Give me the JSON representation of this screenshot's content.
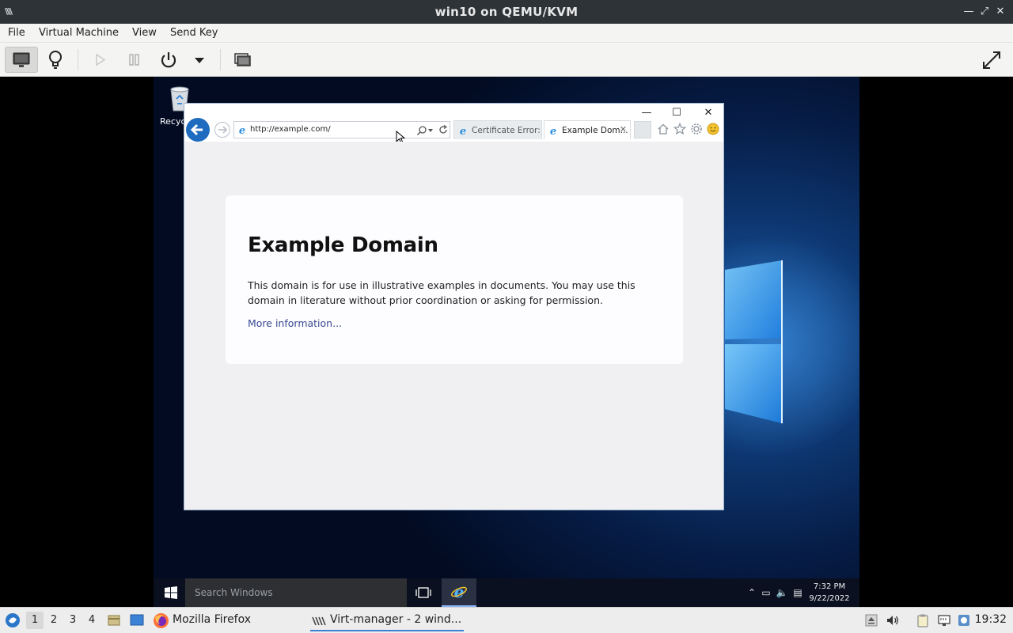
{
  "vm_window": {
    "title": "win10 on QEMU/KVM",
    "menu": [
      "File",
      "Virtual Machine",
      "View",
      "Send Key"
    ],
    "window_controls": [
      "—",
      "⤢",
      "✕"
    ]
  },
  "desktop": {
    "recycle_bin_label": "Recycl"
  },
  "ie": {
    "address": "http://example.com/",
    "tabs": [
      {
        "label": "Certificate Error: ..."
      },
      {
        "label": "Example Dom...",
        "close": "✕"
      }
    ],
    "window_controls": [
      "—",
      "☐",
      "✕"
    ]
  },
  "page": {
    "heading": "Example Domain",
    "body": "This domain is for use in illustrative examples in documents. You may use this domain in literature without prior coordination or asking for permission.",
    "link": "More information..."
  },
  "win_taskbar": {
    "search_placeholder": "Search Windows",
    "time": "7:32 PM",
    "date": "9/22/2022"
  },
  "host_panel": {
    "workspaces": [
      "1",
      "2",
      "3",
      "4"
    ],
    "active_workspace": "1",
    "tasks": [
      {
        "label": "Mozilla Firefox"
      },
      {
        "label": "Virt-manager - 2 wind..."
      }
    ],
    "clock": "19:32"
  }
}
